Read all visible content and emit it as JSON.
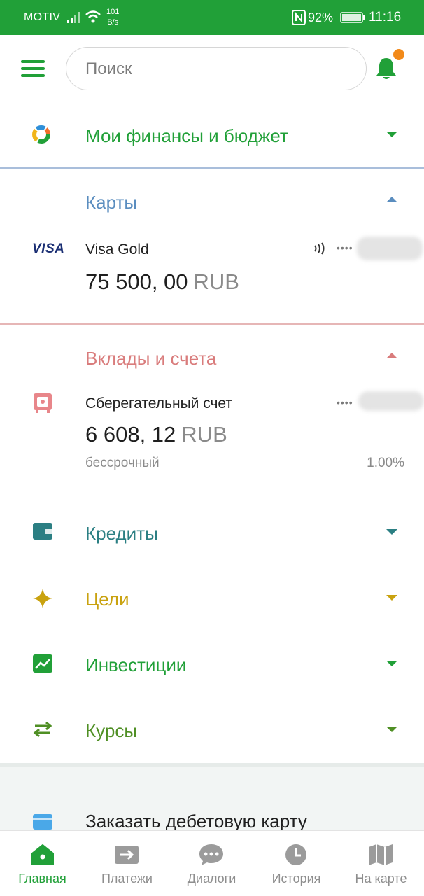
{
  "status_bar": {
    "carrier": "MOTIV",
    "speed_value": "101",
    "speed_unit": "B/s",
    "battery_percent": "92%",
    "time": "11:16"
  },
  "search": {
    "placeholder": "Поиск"
  },
  "sections": {
    "finance": {
      "label": "Мои финансы и бюджет",
      "color": "#21a038"
    },
    "cards": {
      "label": "Карты",
      "color": "#5a8dbf",
      "items": [
        {
          "brand": "VISA",
          "name": "Visa Gold",
          "amount": "75 500, 00",
          "currency": "RUB",
          "masked": "••••"
        }
      ]
    },
    "deposits": {
      "label": "Вклады и счета",
      "color": "#d97c7c",
      "items": [
        {
          "name": "Сберегательный счет",
          "amount": "6 608, 12",
          "currency": "RUB",
          "masked": "••••",
          "term": "бессрочный",
          "rate": "1.00%"
        }
      ]
    },
    "credits": {
      "label": "Кредиты",
      "color": "#2b7f83"
    },
    "goals": {
      "label": "Цели",
      "color": "#c9a20f"
    },
    "investments": {
      "label": "Инвестиции",
      "color": "#21a038"
    },
    "rates": {
      "label": "Курсы",
      "color": "#4f8f24"
    }
  },
  "promo": {
    "label": "Заказать дебетовую карту"
  },
  "bottom_nav": [
    {
      "label": "Главная",
      "icon": "home-icon",
      "active": true
    },
    {
      "label": "Платежи",
      "icon": "payments-icon",
      "active": false
    },
    {
      "label": "Диалоги",
      "icon": "dialogs-icon",
      "active": false
    },
    {
      "label": "История",
      "icon": "history-icon",
      "active": false
    },
    {
      "label": "На карте",
      "icon": "map-icon",
      "active": false
    }
  ],
  "colors": {
    "brand_green": "#21a038",
    "notification": "#f28a19"
  }
}
